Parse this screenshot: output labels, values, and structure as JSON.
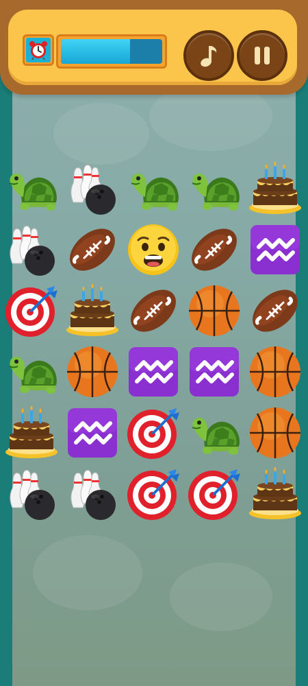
{
  "hud": {
    "timer_icon": "alarm-clock-icon",
    "timer_progress_fraction": 0.68,
    "music_icon": "music-note-icon",
    "pause_icon": "pause-icon"
  },
  "colors": {
    "frame_brown": "#a86a2c",
    "panel_yellow": "#fbc44a",
    "progress_blue": "#27b8e3",
    "button_brown": "#7a4416",
    "side_teal": "#1a7d78"
  },
  "board": {
    "columns": 5,
    "rows": 6,
    "tiles": [
      [
        "turtle",
        "bowling",
        "turtle",
        "turtle",
        "cake"
      ],
      [
        "bowling",
        "football",
        "anxious-face",
        "football",
        "aquarius"
      ],
      [
        "target",
        "cake",
        "football",
        "basketball",
        "football"
      ],
      [
        "turtle",
        "basketball",
        "aquarius",
        "aquarius",
        "basketball"
      ],
      [
        "cake",
        "aquarius",
        "target",
        "turtle",
        "basketball"
      ],
      [
        "bowling",
        "bowling",
        "target",
        "target",
        "cake"
      ]
    ]
  }
}
